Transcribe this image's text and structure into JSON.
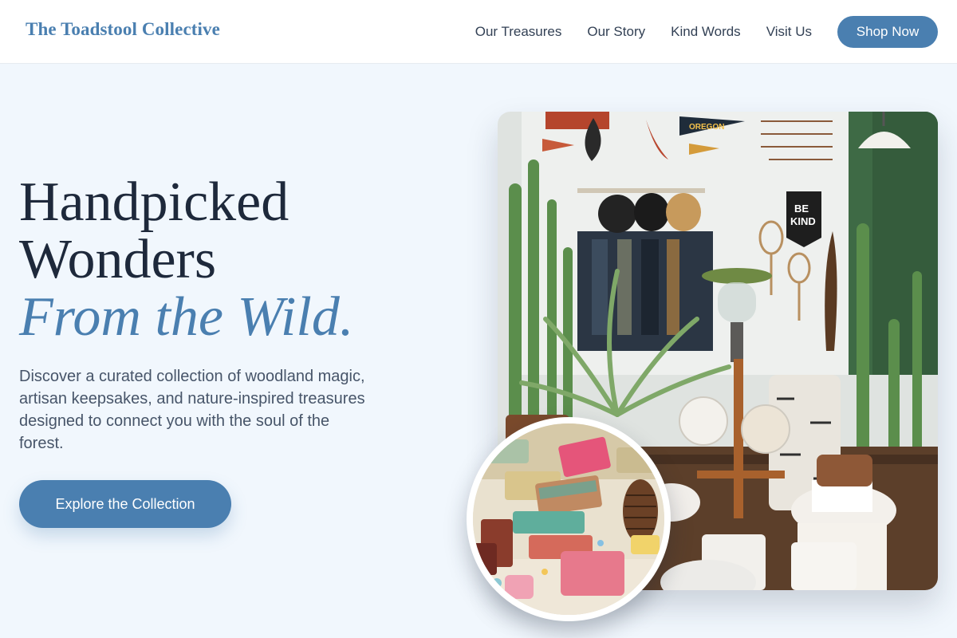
{
  "header": {
    "brand": "The Toadstool Collective",
    "nav": [
      {
        "label": "Our Treasures"
      },
      {
        "label": "Our Story"
      },
      {
        "label": "Kind Words"
      },
      {
        "label": "Visit Us"
      }
    ],
    "cta_label": "Shop Now"
  },
  "hero": {
    "title_line1": "Handpicked",
    "title_line2": "Wonders",
    "title_accent": "From the Wild.",
    "description": "Discover a curated collection of woodland magic, artisan keepsakes, and nature-inspired treasures designed to connect you with the soul of the forest.",
    "cta_label": "Explore the Collection"
  },
  "images": {
    "main": {
      "signs": [
        "OREGON",
        "BE",
        "KIND"
      ]
    }
  },
  "colors": {
    "accent": "#4a7fb0",
    "heading": "#1e293b",
    "body_text": "#475569",
    "page_background": "#f1f7fd"
  }
}
